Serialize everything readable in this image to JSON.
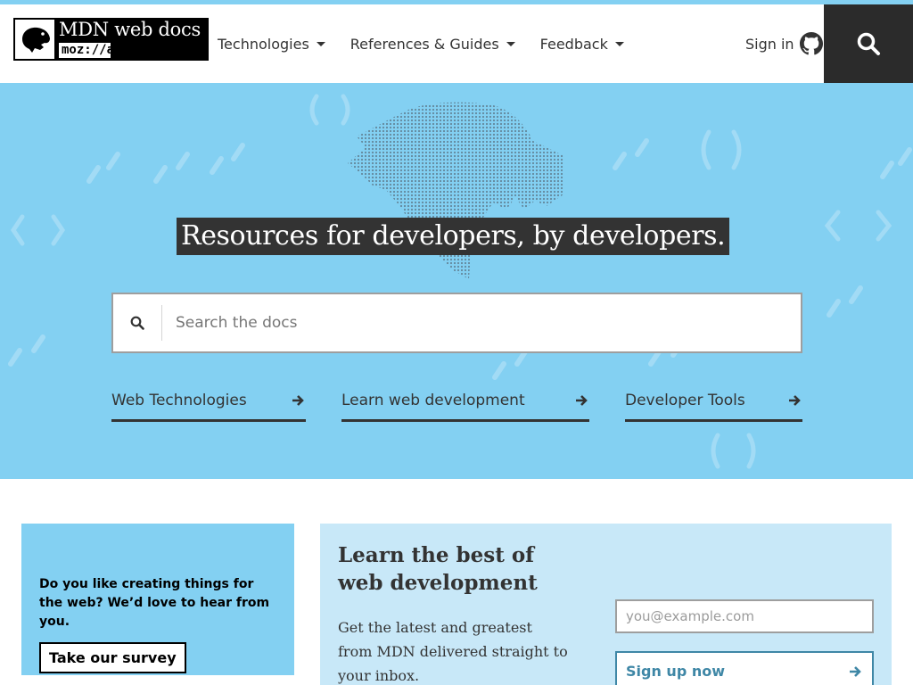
{
  "header": {
    "logo_title": "MDN web docs",
    "logo_moz": "moz://a",
    "nav": [
      {
        "label": "Technologies"
      },
      {
        "label": "References & Guides"
      },
      {
        "label": "Feedback"
      }
    ],
    "signin_label": "Sign in",
    "signin_icon": "github-icon",
    "search_icon": "search-icon"
  },
  "hero": {
    "headline": "Resources for developers, by developers.",
    "search_placeholder": "Search the docs",
    "links": [
      {
        "label": "Web Technologies"
      },
      {
        "label": "Learn web development"
      },
      {
        "label": "Developer Tools"
      }
    ]
  },
  "survey": {
    "text": "Do you like creating things for the web? We’d love to hear from you.",
    "button": "Take our survey"
  },
  "newsletter": {
    "title": "Learn the best of web development",
    "description": "Get the latest and greatest from MDN delivered straight to your inbox.",
    "email_placeholder": "you@example.com",
    "signup_label": "Sign up now"
  },
  "colors": {
    "hero_bg": "#83d0f2",
    "header_dark": "#2b2b2b",
    "newsletter_bg": "#c8e8f8",
    "signup_accent": "#3f87a6"
  }
}
